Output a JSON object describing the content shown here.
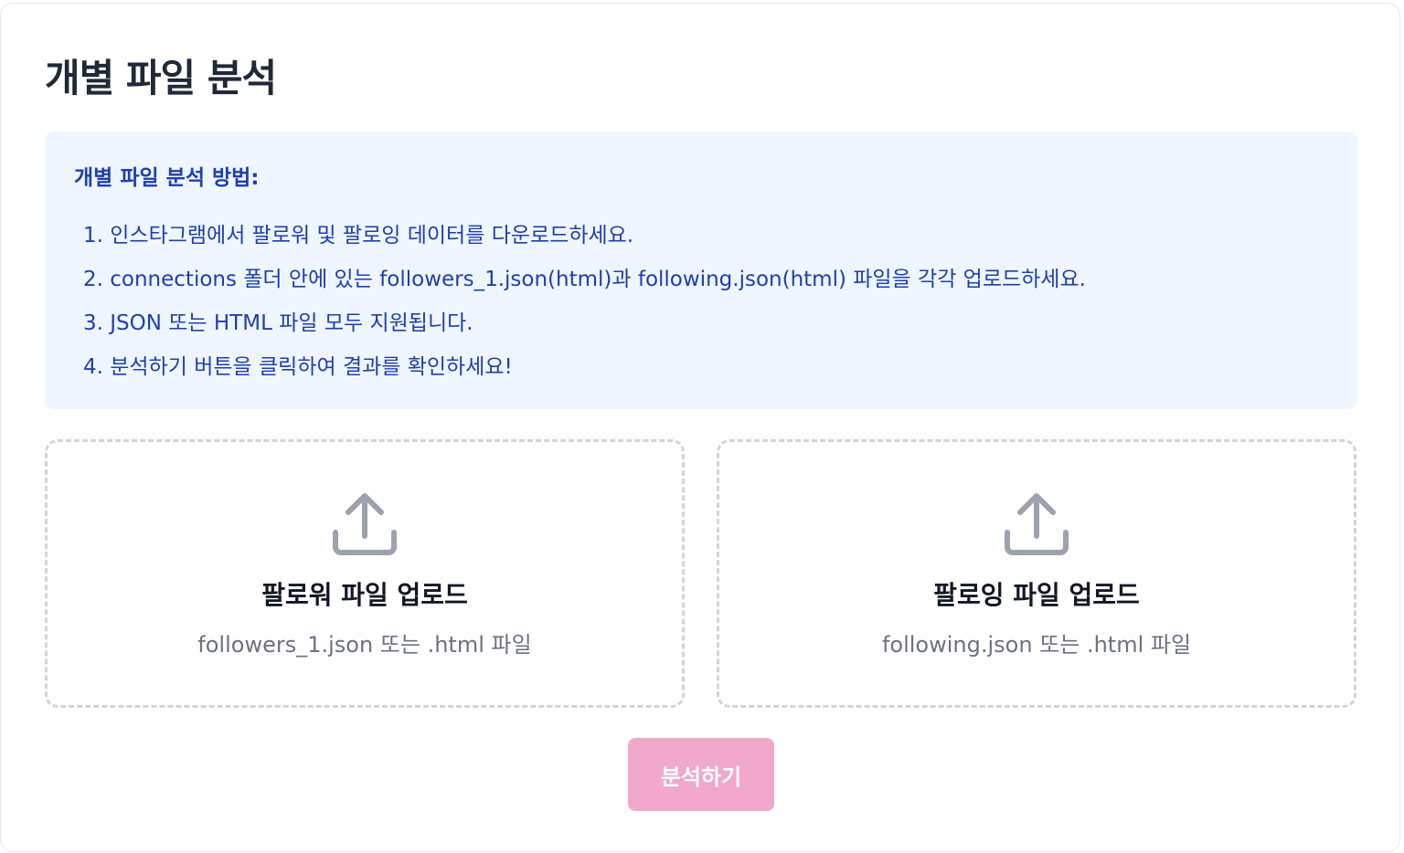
{
  "page": {
    "title": "개별 파일 분석"
  },
  "instructions": {
    "title": "개별 파일 분석 방법:",
    "steps": [
      "1. 인스타그램에서 팔로워 및 팔로잉 데이터를 다운로드하세요.",
      "2. connections 폴더 안에 있는 followers_1.json(html)과 following.json(html) 파일을 각각 업로드하세요.",
      "3. JSON 또는 HTML 파일 모두 지원됩니다.",
      "4. 분석하기 버튼을 클릭하여 결과를 확인하세요!"
    ]
  },
  "uploads": {
    "followers": {
      "icon": "upload-icon",
      "title": "팔로워 파일 업로드",
      "hint": "followers_1.json 또는 .html 파일"
    },
    "following": {
      "icon": "upload-icon",
      "title": "팔로잉 파일 업로드",
      "hint": "following.json 또는 .html 파일"
    }
  },
  "actions": {
    "analyze_label": "분석하기"
  },
  "colors": {
    "info_background": "#eff6ff",
    "info_text": "#1e40af",
    "button_disabled": "#f0a8cb",
    "icon": "#9ca3af",
    "dashed_border": "#d1d5db"
  }
}
